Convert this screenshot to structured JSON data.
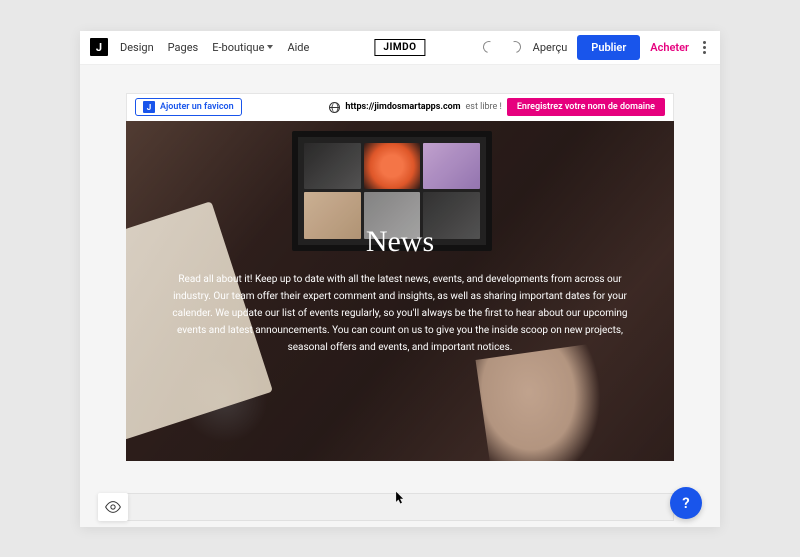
{
  "topbar": {
    "brand": "JIMDO",
    "nav": {
      "design": "Design",
      "pages": "Pages",
      "eboutique": "E-boutique",
      "aide": "Aide"
    },
    "actions": {
      "apercu": "Aperçu",
      "publier": "Publier",
      "acheter": "Acheter"
    }
  },
  "domainBar": {
    "faviconBtn": "Ajouter un favicon",
    "url": "https://jimdosmartapps.com",
    "free": "est libre !",
    "register": "Enregistrez votre nom de domaine"
  },
  "hero": {
    "title": "News",
    "body": "Read all about it! Keep up to date with all the latest news, events, and developments from across our industry. Our team offer their expert comment and insights, as well as sharing important dates for your calender. We update our list of events regularly, so you'll always be the first to hear about our upcoming events and latest announcements. You can count on us to give you the inside scoop on new projects, seasonal offers and events, and important notices."
  },
  "help": {
    "label": "?"
  },
  "colors": {
    "primary": "#1955eb",
    "accent": "#e6007e"
  }
}
